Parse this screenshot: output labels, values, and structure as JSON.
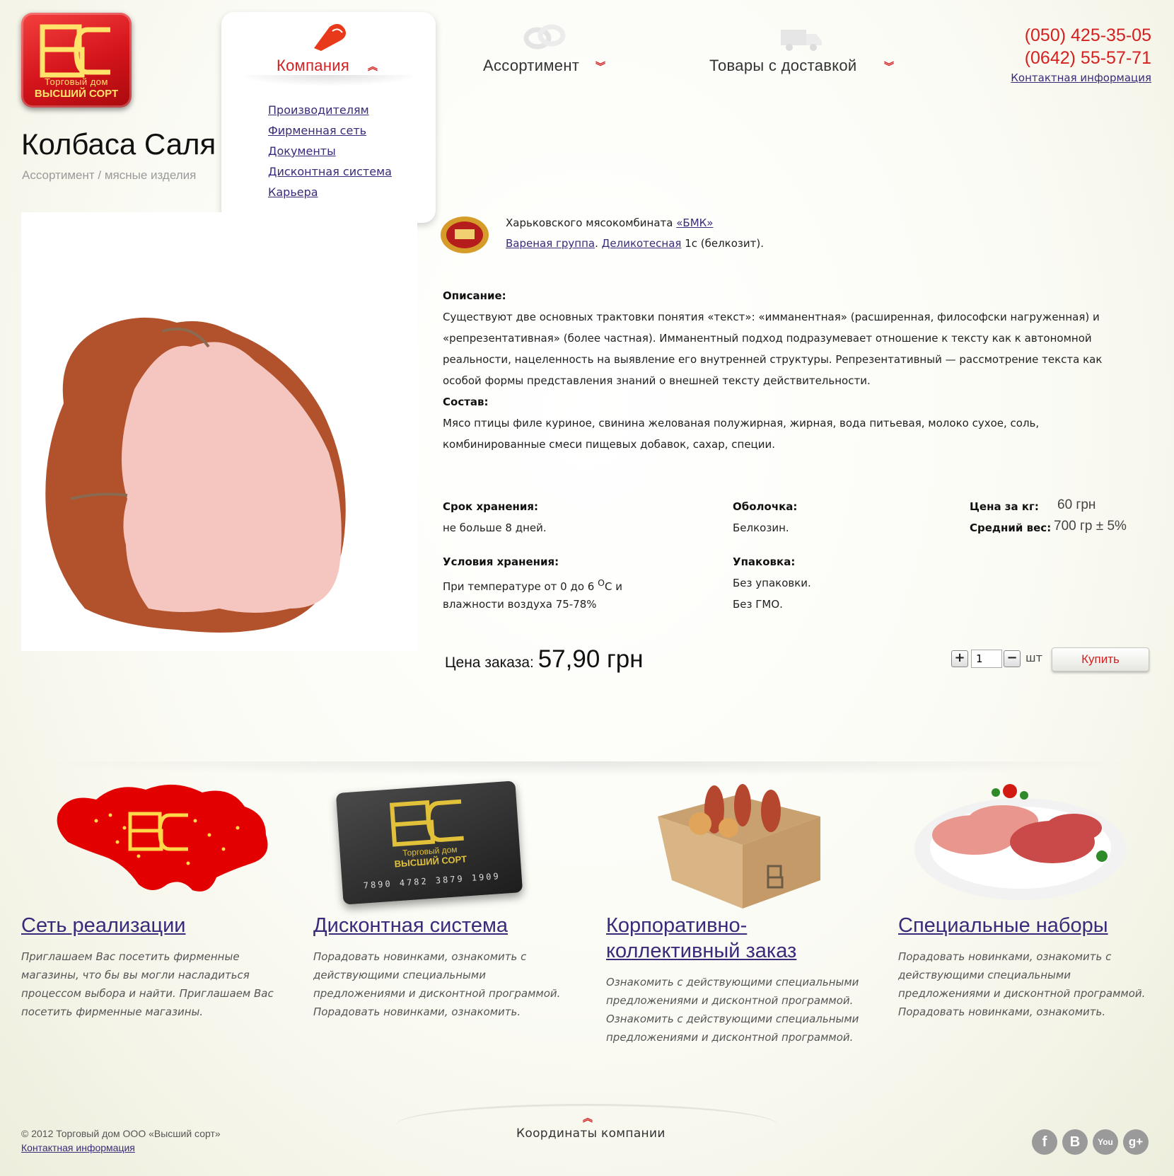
{
  "logo": {
    "line1": "Торговый дом",
    "line2": "ВЫСШИЙ СОРТ"
  },
  "nav": {
    "company": "Компания",
    "assortment": "Ассортимент",
    "delivery": "Товары с доставкой",
    "submenu": [
      "Производителям",
      "Фирменная сеть",
      "Документы",
      "Дисконтная система",
      "Карьера"
    ]
  },
  "header": {
    "phone1": "(050) 425-35-05",
    "phone2": "(0642) 55-57-71",
    "contact_link": "Контактная информация"
  },
  "product": {
    "title": "Колбаса Саля",
    "breadcrumb": "Ассортимент / мясные изделия",
    "manufacturer_prefix": "Харьковского мясокомбината ",
    "manufacturer_link": "«БМК»",
    "group_link": "Вареная группа",
    "dot": ". ",
    "subgroup_link": "Деликотесная",
    "grade": " 1с (белкозит).",
    "description_label": "Описание:",
    "description": "Существуют две основных трактовки понятия «текст»: «имманентная» (расширенная, философски нагруженная) и «репрезентативная» (более частная). Имманентный подход подразумевает отношение к тексту как к автономной реальности, нацеленность на выявление его внутренней структуры. Репрезентативный — рассмотрение текста как особой формы представления знаний о внешней тексту действительности.",
    "composition_label": "Состав:",
    "composition": "Мясо птицы филе куриное, свинина желованая полужирная, жирная, вода питьевая, молоко сухое, соль, комбинированные смеси пищевых добавок, сахар, специи.",
    "shelf_label": "Срок хранения:",
    "shelf_value": "не больше 8 дней.",
    "storage_label": "Условия хранения:",
    "storage_value_1": "При температуре от 0 до 6 ",
    "storage_sup": "О",
    "storage_value_1b": "С и",
    "storage_value_2": "влажности воздуха 75-78%",
    "casing_label": "Оболочка:",
    "casing_value": "Белкозин.",
    "package_label": "Упаковка:",
    "package_value": "Без упаковки.",
    "gmo": "Без ГМО.",
    "price_kg_label": "Цена за кг:",
    "price_kg_value": "60 грн",
    "avg_weight_label": "Средний вес:",
    "avg_weight_value": "700 гр ± 5%",
    "order_price_label": "Цена заказа: ",
    "order_price_value": "57,90 грн",
    "qty": "1",
    "qty_unit": "шт",
    "plus": "+",
    "minus": "−",
    "buy": "Купить"
  },
  "features": [
    {
      "title": "Сеть реализации",
      "text": "Приглашаем Вас посетить фирменные магазины, что бы вы могли насладиться процессом выбора и найти. Приглашаем Вас посетить фирменные магазины."
    },
    {
      "title": "Дисконтная система",
      "text": "Порадовать новинками, ознакомить с действующими специальными предложениями и дисконтной программой. Порадовать новинками, ознакомить."
    },
    {
      "title": "Корпоративно-коллективный заказ",
      "text": "Ознакомить с действующими специальными предложениями и дисконтной программой. Ознакомить с действующими специальными предложениями и дисконтной программой."
    },
    {
      "title": "Специальные наборы",
      "text": "Порадовать новинками, ознакомить с действующими специальными предложениями и дисконтной программой. Порадовать новинками, ознакомить."
    }
  ],
  "card": {
    "line1": "Торговый дом",
    "line2": "ВЫСШИЙ СОРТ",
    "number": "7890 4782 3879 1909"
  },
  "footer": {
    "copyright": "© 2012 Торговый дом ООО «Высший сорт»",
    "contact_link": "Контактная информация",
    "coordinates": "Координаты компании",
    "social": [
      "f",
      "B",
      "You",
      "g+"
    ]
  },
  "colors": {
    "accent": "#d42020",
    "link": "#3b2a7a",
    "gold": "#ffe36a"
  }
}
